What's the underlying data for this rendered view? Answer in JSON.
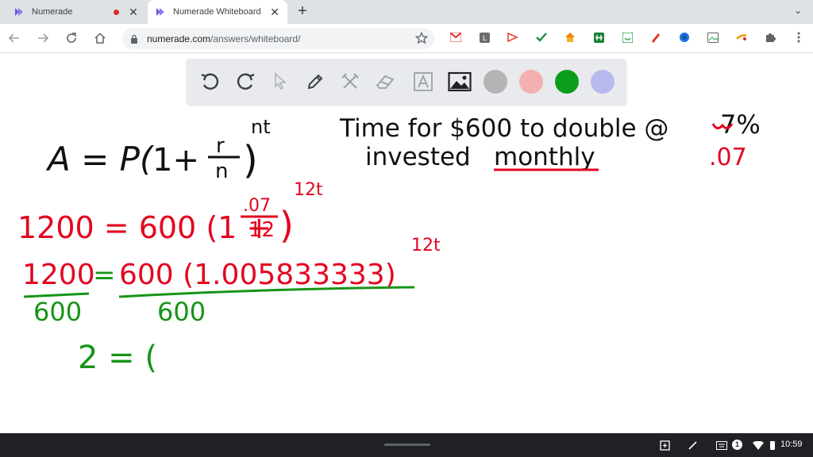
{
  "tabs": [
    {
      "title": "Numerade",
      "icon": "numerade-logo-icon",
      "recording": true
    },
    {
      "title": "Numerade Whiteboard",
      "icon": "numerade-logo-icon",
      "active": true
    }
  ],
  "address_bar": {
    "host": "numerade.com",
    "path": "/answers/whiteboard/"
  },
  "whiteboard_tools": [
    "undo-icon",
    "redo-icon",
    "pointer-icon",
    "pen-icon",
    "tools-icon",
    "eraser-icon",
    "text-icon",
    "image-icon"
  ],
  "colors": {
    "gray": "#b4b4b4",
    "pink": "#f4b0b0",
    "green": "#0c9d1d",
    "lavender": "#b8b9ee",
    "ink_black": "#111111",
    "ink_red": "#e3061f",
    "ink_green": "#179417"
  },
  "handwriting": {
    "formula": "A = P(1 + r/n)^nt",
    "problem_line1": "Time for $600 to double @ 7%",
    "problem_line2": "invested monthly",
    "rate_decimal": ".07",
    "step1": "1200 = 600(1 + .07/12)^12t",
    "step2": "1200 = 600(1.005833333)^12t",
    "step2_divisors": "600    600",
    "step3": "2 = ("
  },
  "shelf": {
    "notification_count": "1",
    "time": "10:59"
  }
}
